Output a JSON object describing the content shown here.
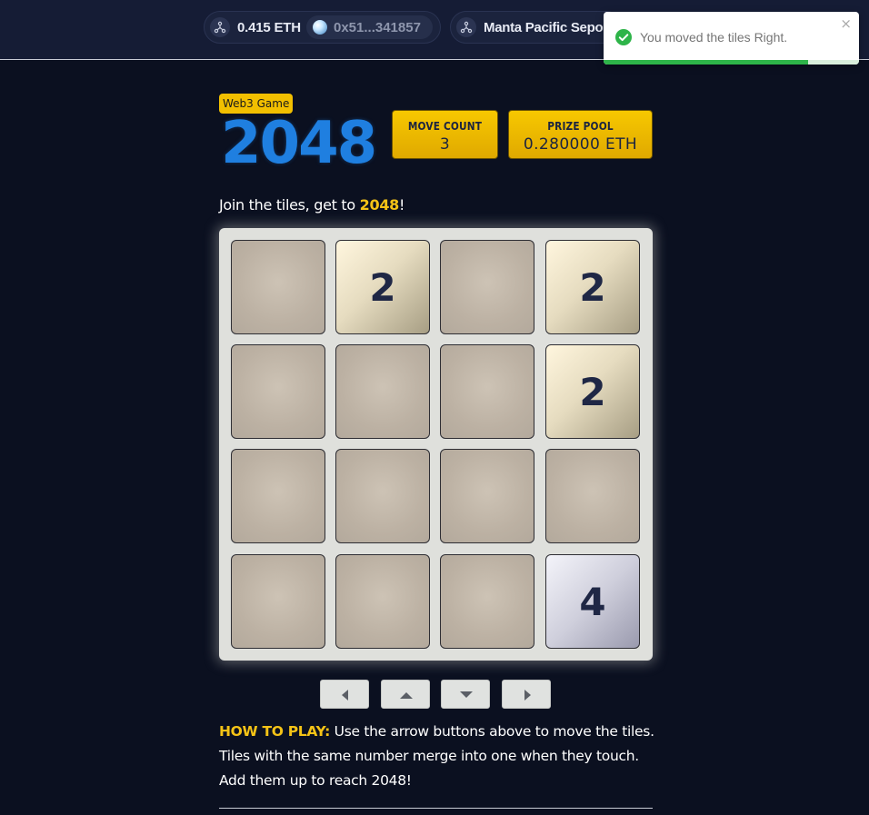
{
  "header": {
    "balance": "0.415 ETH",
    "address": "0x51...341857",
    "network": "Manta Pacific Sepolia"
  },
  "toast": {
    "message": "You moved the tiles Right.",
    "close_glyph": "×",
    "icon": "check-circle-icon",
    "progress": 0.8,
    "color": "#2eb449"
  },
  "game": {
    "badge": "Web3 Game",
    "title": "2048",
    "move_count_label": "MOVE COUNT",
    "move_count": "3",
    "prize_pool_label": "PRIZE POOL",
    "prize_pool": "0.280000 ETH",
    "tagline_prefix": "Join the tiles, get to ",
    "tagline_highlight": "2048",
    "tagline_suffix": "!"
  },
  "board": {
    "rows": [
      [
        "",
        "2",
        "",
        "2"
      ],
      [
        "",
        "",
        "",
        "2"
      ],
      [
        "",
        "",
        "",
        ""
      ],
      [
        "",
        "",
        "",
        "4"
      ]
    ]
  },
  "controls": {
    "left": "arrow-left-icon",
    "up": "arrow-up-icon",
    "down": "arrow-down-icon",
    "right": "arrow-right-icon"
  },
  "instructions": {
    "label": "HOW TO PLAY:",
    "line1": " Use the arrow buttons above to move the tiles.",
    "line2": "Tiles with the same number merge into one when they touch.",
    "line3": "Add them up to reach 2048!"
  },
  "colors": {
    "accent_yellow": "#f5c316",
    "title_blue": "#1f7fe0",
    "background": "#0b1020"
  }
}
